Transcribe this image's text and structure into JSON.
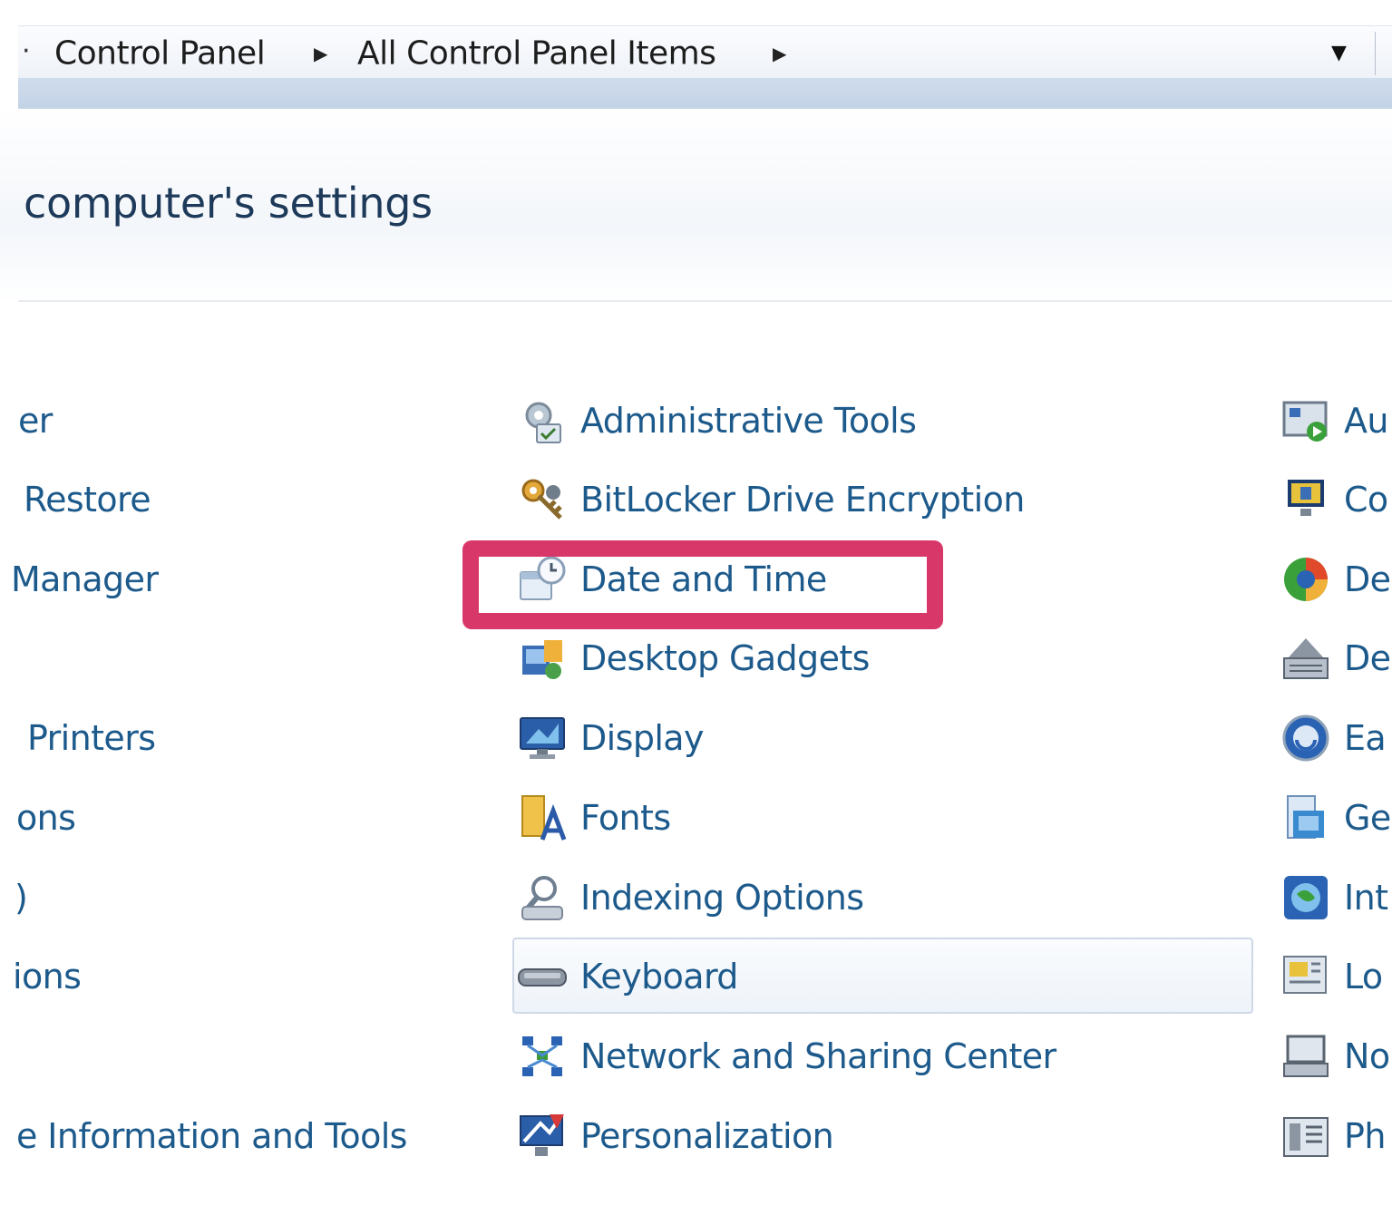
{
  "address_bar": {
    "lead": "·",
    "crumbs": [
      "Control Panel",
      "All Control Panel Items"
    ]
  },
  "header": {
    "title": "computer's settings"
  },
  "columns": {
    "left": [
      {
        "label": "er"
      },
      {
        "label": "Restore"
      },
      {
        "label": "Manager"
      },
      {
        "label": ""
      },
      {
        "label": "Printers"
      },
      {
        "label": "ons"
      },
      {
        "label": ")"
      },
      {
        "label": "ions"
      },
      {
        "label": ""
      },
      {
        "label": "e Information and Tools"
      }
    ],
    "middle": [
      {
        "label": "Administrative Tools",
        "icon": "administrative-tools-icon"
      },
      {
        "label": "BitLocker Drive Encryption",
        "icon": "bitlocker-icon"
      },
      {
        "label": "Date and Time",
        "icon": "date-time-icon"
      },
      {
        "label": "Desktop Gadgets",
        "icon": "desktop-gadgets-icon"
      },
      {
        "label": "Display",
        "icon": "display-icon"
      },
      {
        "label": "Fonts",
        "icon": "fonts-icon"
      },
      {
        "label": "Indexing Options",
        "icon": "indexing-options-icon"
      },
      {
        "label": "Keyboard",
        "icon": "keyboard-icon"
      },
      {
        "label": "Network and Sharing Center",
        "icon": "network-icon"
      },
      {
        "label": "Personalization",
        "icon": "personalization-icon"
      }
    ],
    "right": [
      {
        "label": "Au",
        "icon": "autoplay-icon"
      },
      {
        "label": "Co",
        "icon": "color-management-icon"
      },
      {
        "label": "De",
        "icon": "default-programs-icon"
      },
      {
        "label": "De",
        "icon": "device-manager-icon"
      },
      {
        "label": "Ea",
        "icon": "ease-of-access-icon"
      },
      {
        "label": "Ge",
        "icon": "getting-started-icon"
      },
      {
        "label": "Int",
        "icon": "internet-options-icon"
      },
      {
        "label": "Lo",
        "icon": "location-sensors-icon"
      },
      {
        "label": "No",
        "icon": "notification-icon"
      },
      {
        "label": "Ph",
        "icon": "phone-modem-icon"
      }
    ]
  },
  "colors": {
    "link": "#1d5a8c",
    "highlight": "#d8376a",
    "band": "#c9d8ea"
  }
}
